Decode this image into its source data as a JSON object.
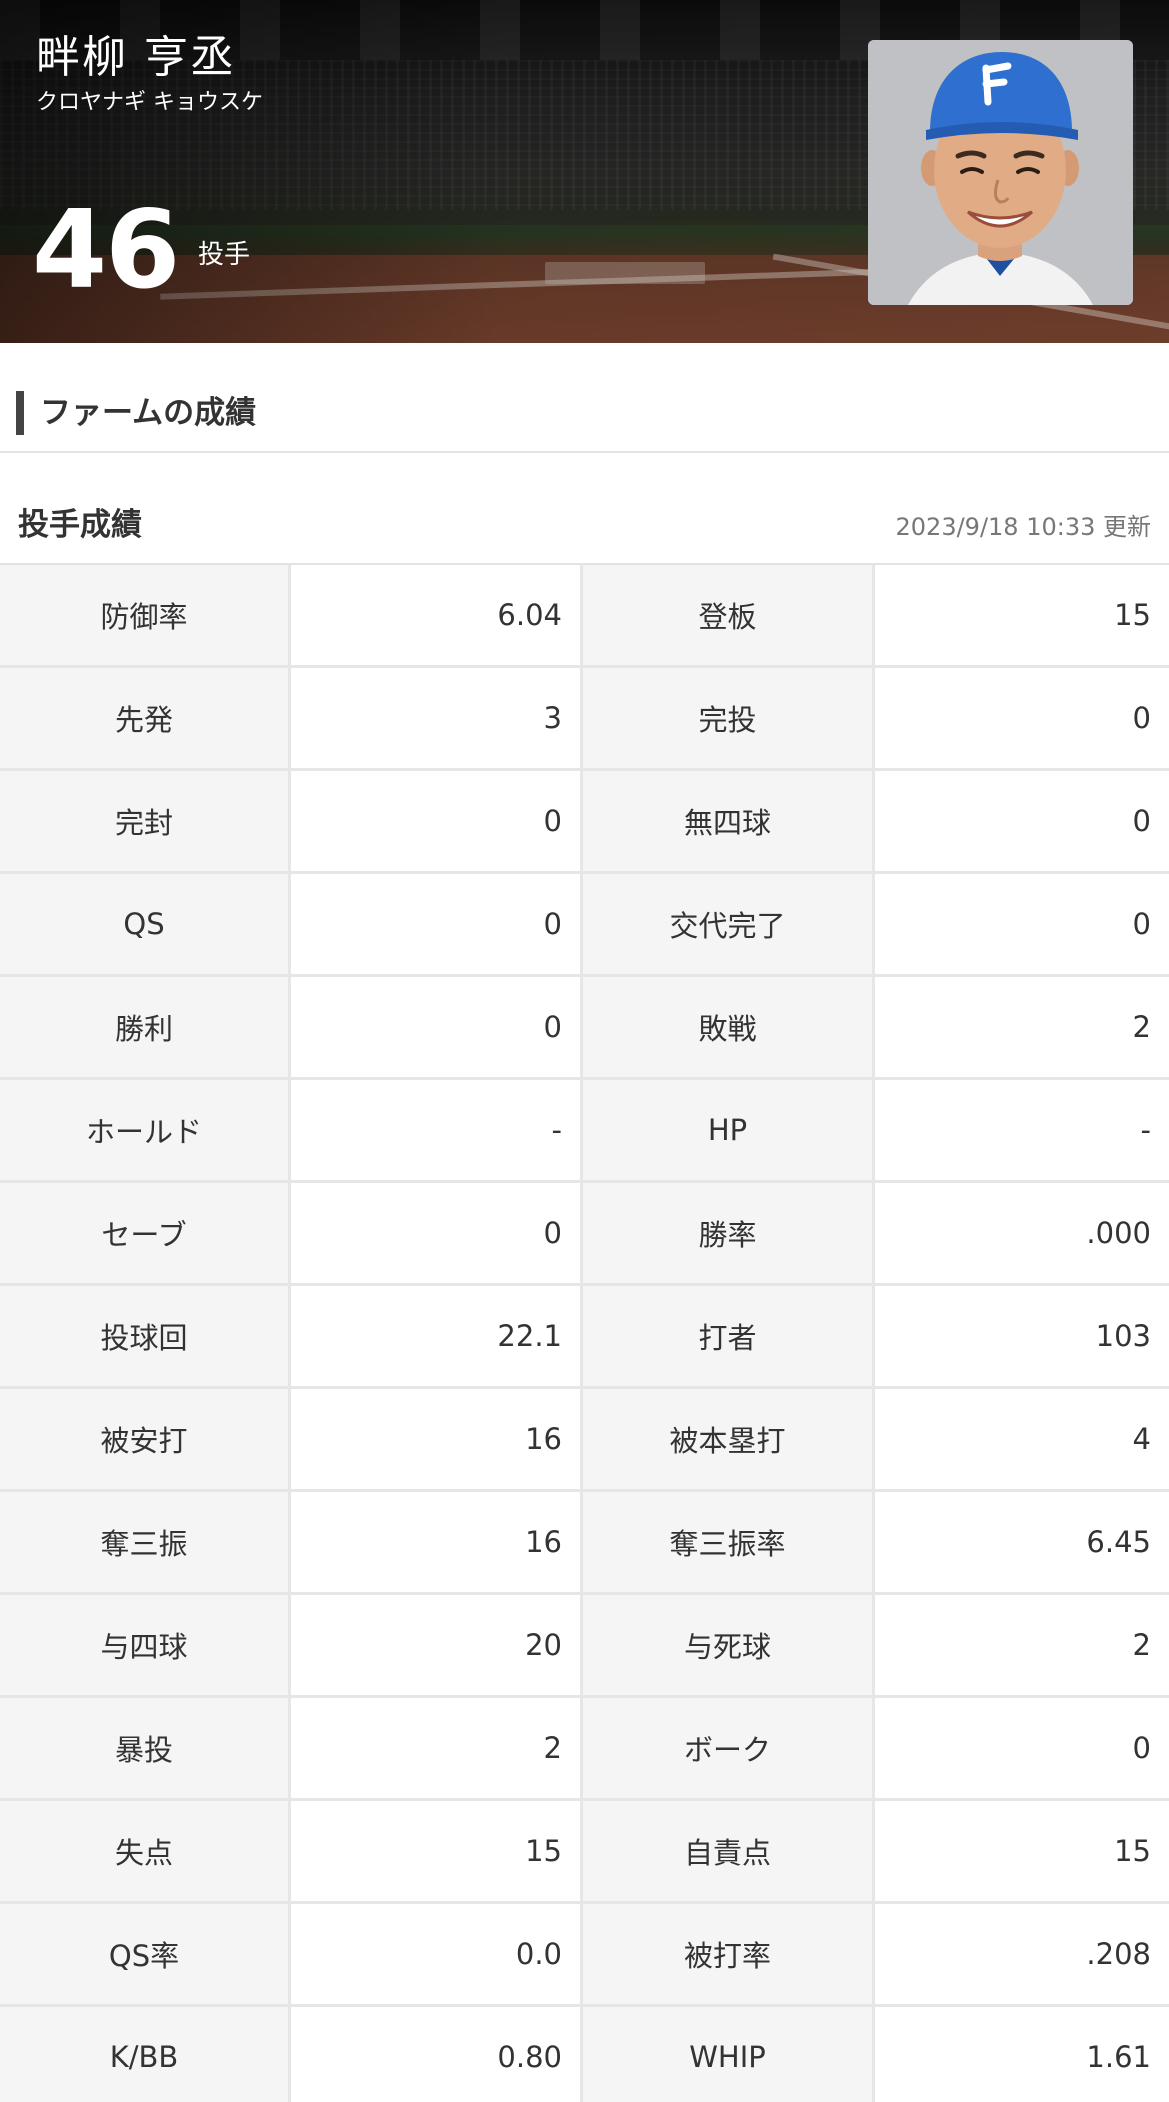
{
  "player": {
    "name": "畔柳 亨丞",
    "kana": "クロヤナギ キョウスケ",
    "number": "46",
    "position": "投手",
    "cap_logo": "F"
  },
  "section": {
    "title": "ファームの成績"
  },
  "pitching": {
    "title": "投手成績",
    "updated": "2023/9/18 10:33 更新",
    "rows": [
      {
        "l1": "防御率",
        "v1": "6.04",
        "l2": "登板",
        "v2": "15"
      },
      {
        "l1": "先発",
        "v1": "3",
        "l2": "完投",
        "v2": "0"
      },
      {
        "l1": "完封",
        "v1": "0",
        "l2": "無四球",
        "v2": "0"
      },
      {
        "l1": "QS",
        "v1": "0",
        "l2": "交代完了",
        "v2": "0"
      },
      {
        "l1": "勝利",
        "v1": "0",
        "l2": "敗戦",
        "v2": "2"
      },
      {
        "l1": "ホールド",
        "v1": "-",
        "l2": "HP",
        "v2": "-"
      },
      {
        "l1": "セーブ",
        "v1": "0",
        "l2": "勝率",
        "v2": ".000"
      },
      {
        "l1": "投球回",
        "v1": "22.1",
        "l2": "打者",
        "v2": "103"
      },
      {
        "l1": "被安打",
        "v1": "16",
        "l2": "被本塁打",
        "v2": "4"
      },
      {
        "l1": "奪三振",
        "v1": "16",
        "l2": "奪三振率",
        "v2": "6.45"
      },
      {
        "l1": "与四球",
        "v1": "20",
        "l2": "与死球",
        "v2": "2"
      },
      {
        "l1": "暴投",
        "v1": "2",
        "l2": "ボーク",
        "v2": "0"
      },
      {
        "l1": "失点",
        "v1": "15",
        "l2": "自責点",
        "v2": "15"
      },
      {
        "l1": "QS率",
        "v1": "0.0",
        "l2": "被打率",
        "v2": ".208"
      },
      {
        "l1": "K/BB",
        "v1": "0.80",
        "l2": "WHIP",
        "v2": "1.61"
      }
    ]
  },
  "colors": {
    "cap_blue": "#2f6fd0",
    "label_background": "#f5f5f5",
    "divider": "#e6e6e6",
    "text": "#333333"
  }
}
